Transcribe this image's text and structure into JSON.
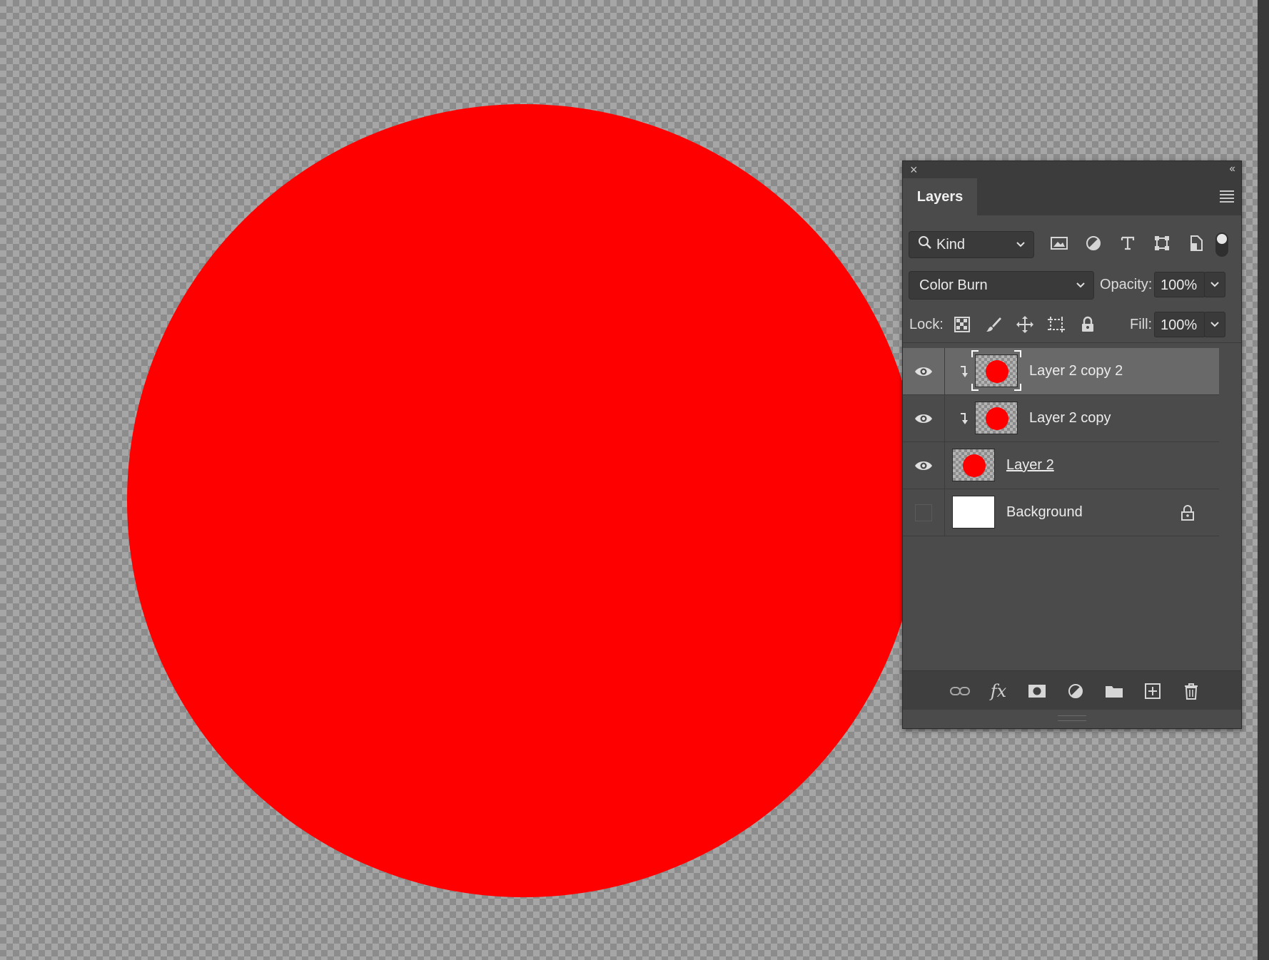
{
  "canvas": {
    "circle_color": "#ff0000"
  },
  "panel": {
    "close_glyph": "×",
    "collapse_glyph": "‹‹",
    "tab_label": "Layers",
    "filter": {
      "kind_label": "Kind",
      "icons": [
        "image-filter-icon",
        "adjustment-filter-icon",
        "type-filter-icon",
        "shape-filter-icon",
        "smart-object-filter-icon"
      ]
    },
    "blend": {
      "mode": "Color Burn",
      "opacity_label": "Opacity:",
      "opacity_value": "100%"
    },
    "lock": {
      "label": "Lock:",
      "fill_label": "Fill:",
      "fill_value": "100%",
      "icons": [
        "lock-transparent-pixels-icon",
        "lock-image-pixels-icon",
        "lock-position-icon",
        "lock-artboard-icon",
        "lock-all-icon"
      ]
    },
    "layers": [
      {
        "name": "Layer 2 copy 2",
        "visible": true,
        "clipped": true,
        "selected": true,
        "thumb": "red-dot"
      },
      {
        "name": "Layer 2 copy",
        "visible": true,
        "clipped": true,
        "selected": false,
        "thumb": "red-dot"
      },
      {
        "name": "Layer 2",
        "visible": true,
        "clipped": false,
        "selected": false,
        "thumb": "red-dot",
        "underlined": true
      },
      {
        "name": "Background",
        "visible": false,
        "clipped": false,
        "selected": false,
        "thumb": "white",
        "locked": true
      }
    ],
    "bottom_icons": [
      "link-layers-icon",
      "fx-icon",
      "add-mask-icon",
      "adjustment-layer-icon",
      "new-group-icon",
      "new-layer-icon",
      "delete-layer-icon"
    ],
    "fx_label": "fx"
  }
}
